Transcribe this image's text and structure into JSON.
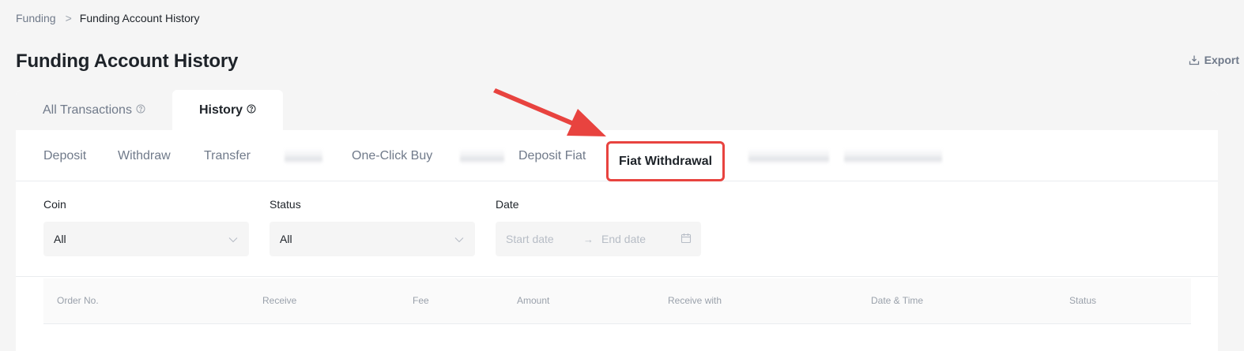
{
  "breadcrumb": {
    "root": "Funding",
    "separator": ">",
    "current": "Funding Account History"
  },
  "page": {
    "title": "Funding Account History"
  },
  "export": {
    "label": "Export",
    "icon": "export-icon"
  },
  "top_tabs": [
    {
      "label": "All Transactions",
      "icon": "help-circle-icon",
      "active": false
    },
    {
      "label": "History",
      "icon": "help-circle-icon",
      "active": true
    }
  ],
  "sub_tabs": [
    {
      "label": "Deposit"
    },
    {
      "label": "Withdraw"
    },
    {
      "label": "Transfer"
    },
    {
      "label": "One-Click Buy"
    },
    {
      "label": "Deposit Fiat"
    },
    {
      "label": "Fiat Withdrawal",
      "highlighted": true
    }
  ],
  "filters": {
    "coin": {
      "label": "Coin",
      "value": "All"
    },
    "status": {
      "label": "Status",
      "value": "All"
    },
    "date": {
      "label": "Date",
      "start_placeholder": "Start date",
      "end_placeholder": "End date",
      "separator": "→"
    }
  },
  "table": {
    "columns": [
      "Order No.",
      "Receive",
      "Fee",
      "Amount",
      "Receive with",
      "Date & Time",
      "Status"
    ]
  },
  "colors": {
    "highlight": "#e8433f",
    "text_primary": "#1e2329",
    "text_secondary": "#707a8a"
  }
}
